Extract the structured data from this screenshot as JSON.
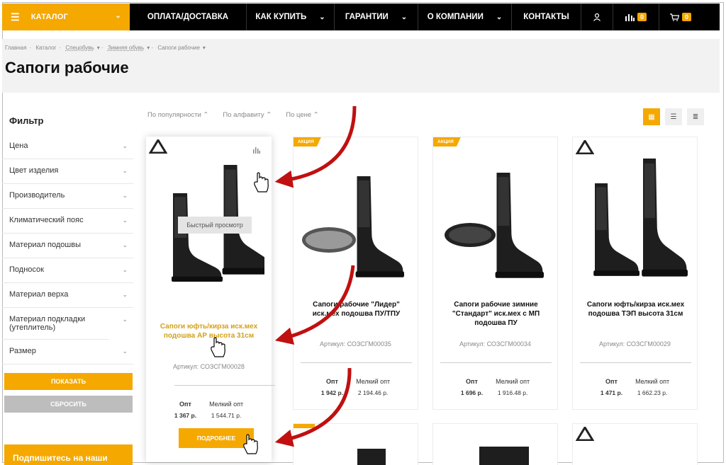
{
  "nav": {
    "catalog": "КАТАЛОГ",
    "items": [
      "ОПЛАТА/ДОСТАВКА",
      "КАК КУПИТЬ",
      "ГАРАНТИИ",
      "О КОМПАНИИ",
      "КОНТАКТЫ"
    ],
    "compare_count": "0",
    "cart_count": "0"
  },
  "breadcrumb": [
    "Главная",
    "Каталог",
    "Спецобувь",
    "Зимняя обувь",
    "Сапоги рабочие"
  ],
  "page_title": "Сапоги рабочие",
  "filter": {
    "title": "Фильтр",
    "items": [
      "Цена",
      "Цвет изделия",
      "Производитель",
      "Климатический пояс",
      "Материал подошвы",
      "Подносок",
      "Материал верха",
      "Материал подкладки (утеплитель)",
      "Размер"
    ],
    "show": "ПОКАЗАТЬ",
    "reset": "СБРОСИТЬ",
    "subscribe": "Подпишитесь на наши"
  },
  "sort": [
    "По популярности",
    "По алфавиту",
    "По цене"
  ],
  "products": [
    {
      "name": "Сапоги юфть/кирза иск.мех подошва АР высота 31см",
      "sku": "Артикул: СОЗСГМ00028",
      "opt_label": "Опт",
      "small_label": "Мелкий опт",
      "opt": "1 367 р.",
      "small": "1 544.71 р.",
      "quick": "Быстрый просмотр",
      "more": "ПОДРОБНЕЕ"
    },
    {
      "badge": "АКЦИЯ",
      "name": "Сапоги рабочие \"Лидер\" иск.мех подошва ПУ/ТПУ",
      "sku": "Артикул: СОЗСГМ00035",
      "opt_label": "Опт",
      "small_label": "Мелкий опт",
      "opt": "1 942 р.",
      "small": "2 194.46 р."
    },
    {
      "badge": "АКЦИЯ",
      "name": "Сапоги рабочие зимние \"Стандарт\" иск.мех с МП подошва ПУ",
      "sku": "Артикул: СОЗСГМ00034",
      "opt_label": "Опт",
      "small_label": "Мелкий опт",
      "opt": "1 696 р.",
      "small": "1 916.48 р."
    },
    {
      "name": "Сапоги юфть/кирза иск.мех подошва ТЭП высота 31см",
      "sku": "Артикул: СОЗСГМ00029",
      "opt_label": "Опт",
      "small_label": "Мелкий опт",
      "opt": "1 471 р.",
      "small": "1 662.23 р."
    }
  ],
  "colors": {
    "accent": "#f5a800",
    "arrow": "#c01010",
    "topbar": "#000000"
  }
}
